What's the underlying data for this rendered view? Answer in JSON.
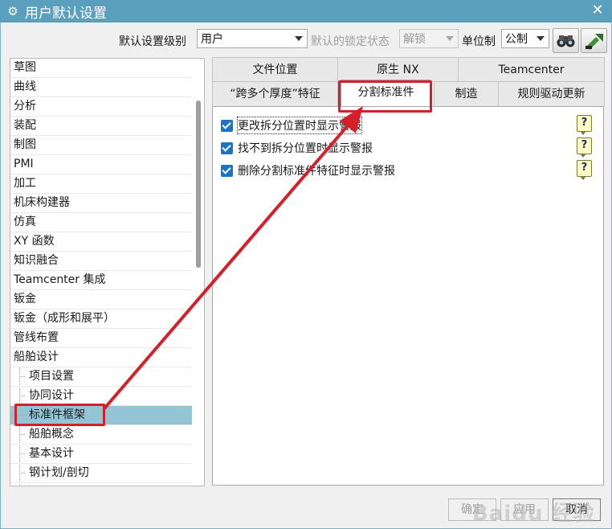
{
  "window": {
    "title": "用户默认设置",
    "icon": "gear-icon",
    "close": "✕"
  },
  "toolbar": {
    "level_label": "默认设置级别",
    "level_value": "用户",
    "lock_label": "默认的锁定状态",
    "lock_value": "解锁",
    "unit_label": "单位制",
    "unit_value": "公制",
    "search_icon": "binoculars-icon",
    "extra_icon": "arrow-tool-icon"
  },
  "tree": {
    "items": [
      "草图",
      "曲线",
      "分析",
      "装配",
      "制图",
      "PMI",
      "加工",
      "机床构建器",
      "仿真",
      "XY 函数",
      "知识融合",
      "Teamcenter 集成",
      "钣金",
      "钣金（成形和展平）",
      "管线布置",
      "船舶设计"
    ],
    "children": [
      "项目设置",
      "协同设计",
      "标准件框架",
      "船舶概念",
      "基本设计",
      "钢计划/剖切"
    ],
    "selected": "标准件框架"
  },
  "tabs": {
    "row1": [
      "文件位置",
      "原生 NX",
      "Teamcenter"
    ],
    "row2": [
      "“跨多个厚度”特征",
      "分割标准件",
      "制造",
      "规则驱动更新"
    ],
    "active": "分割标准件"
  },
  "options": [
    {
      "label": "更改拆分位置时显示警报",
      "checked": true
    },
    {
      "label": "找不到拆分位置时显示警报",
      "checked": true
    },
    {
      "label": "删除分割标准件特征时显示警报",
      "checked": true
    }
  ],
  "help_glyph": "?",
  "buttons": {
    "ok": "确定",
    "apply": "应用",
    "cancel": "取消"
  },
  "watermark": "Baidu 经验",
  "colors": {
    "titlebar": "#5b9fbf",
    "selection": "#94c5d5",
    "highlight": "#d4202a",
    "checkbox": "#1b74c7"
  }
}
